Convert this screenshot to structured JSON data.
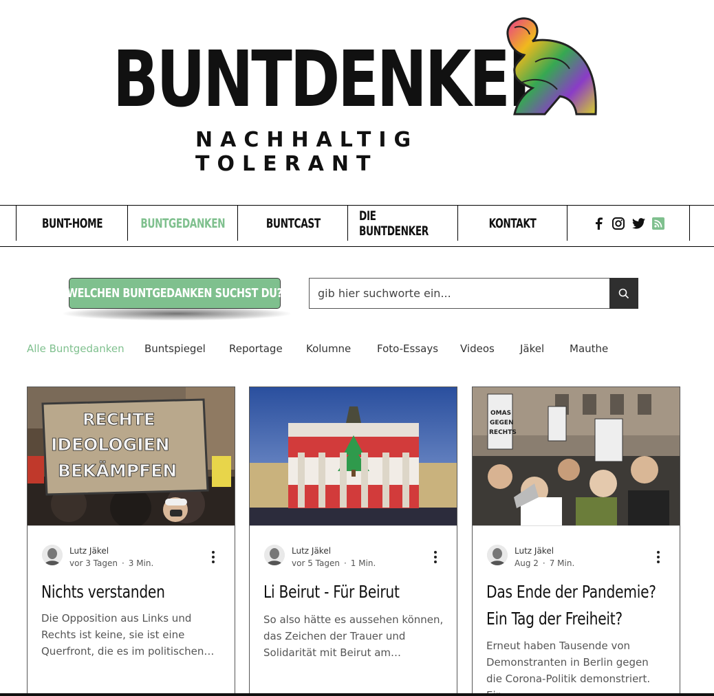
{
  "header": {
    "logo_text": "BUNTDENKER",
    "tagline": "NACHHALTIG TOLERANT"
  },
  "nav": {
    "items": [
      {
        "label": "BUNT-HOME"
      },
      {
        "label": "BUNTGEDANKEN"
      },
      {
        "label": "BUNTCAST"
      },
      {
        "label": "DIE BUNTDENKER"
      },
      {
        "label": "KONTAKT"
      }
    ],
    "social": [
      "facebook-icon",
      "instagram-icon",
      "twitter-icon",
      "rss-icon"
    ]
  },
  "search": {
    "badge_label": "WELCHEN BUNTGEDANKEN SUCHST DU?",
    "placeholder": "gib hier suchworte ein..."
  },
  "categories": [
    "Alle Buntgedanken",
    "Buntspiegel",
    "Reportage",
    "Kolumne",
    "Foto-Essays",
    "Videos",
    "Jäkel",
    "Mauthe"
  ],
  "posts": [
    {
      "author": "Lutz Jäkel",
      "date": "vor 3 Tagen",
      "read_time": "3 Min.",
      "title": "Nichts verstanden",
      "excerpt": "Die Opposition aus Links und Rechts ist keine, sie ist eine Querfront, die es im politischen…",
      "image_text": [
        "RECHTE",
        "IDEOLOGIEN",
        "BEKÄMPFEN"
      ]
    },
    {
      "author": "Lutz Jäkel",
      "date": "vor 5 Tagen",
      "read_time": "1 Min.",
      "title": "Li Beirut - Für Beirut",
      "excerpt": "So also hätte es aussehen können, das Zeichen der Trauer und Solidarität mit Beirut am…"
    },
    {
      "author": "Lutz Jäkel",
      "date": "Aug 2",
      "read_time": "7 Min.",
      "title": "Das Ende der Pandemie? Ein Tag der Freiheit?",
      "excerpt": "Erneut haben Tausende von Demonstranten in Berlin gegen die Corona-Politik demonstriert. Ein…",
      "image_text": [
        "OMAS",
        "GEGEN",
        "RECHTS"
      ]
    }
  ],
  "colors": {
    "accent": "#7fc08e",
    "dark": "#2f2f2f"
  }
}
